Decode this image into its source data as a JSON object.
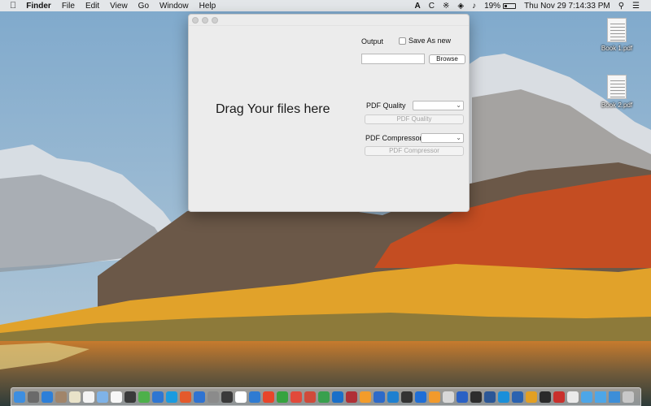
{
  "menubar": {
    "apple_icon": "apple-logo-icon",
    "menus": [
      "Finder",
      "File",
      "Edit",
      "View",
      "Go",
      "Window",
      "Help"
    ],
    "status": {
      "battery_percent": "19%",
      "datetime": "Thu Nov 29  7:14:33 PM",
      "c_label": "C"
    }
  },
  "desktop": {
    "icons": [
      {
        "label": "Book 1.pdf"
      },
      {
        "label": "Book 2.pdf"
      }
    ]
  },
  "window": {
    "drop_text": "Drag Your files here",
    "output_label": "Output",
    "save_as_new_label": "Save As new",
    "output_path_value": "",
    "browse_label": "Browse",
    "pdf_quality_label": "PDF Quality",
    "pdf_quality_button": "PDF Quality",
    "pdf_compressor_label": "PDF Compressor",
    "pdf_compressor_button": "PDF Compressor"
  },
  "dock": {
    "colors": [
      "#3d8ee0",
      "#6a6a6a",
      "#2d7fd8",
      "#a1856a",
      "#e9e3c9",
      "#f4f4f4",
      "#7fb3e8",
      "#f7f7f7",
      "#3a3a3a",
      "#4db04a",
      "#2f76d2",
      "#1a9be0",
      "#e45a2b",
      "#2f73d1",
      "#8b8b8b",
      "#3a3a3a",
      "#ffffff",
      "#2f7bd2",
      "#e8452a",
      "#36a33f",
      "#e14a3b",
      "#d04a3a",
      "#38a04d",
      "#1a6fc9",
      "#b03036",
      "#f39c2a",
      "#2d6ac9",
      "#1e80d0",
      "#333333",
      "#1f6ed6",
      "#f29a2c",
      "#d8d8d8",
      "#2a61c4",
      "#2d2d2d",
      "#2b5797",
      "#1a8fd9",
      "#2a62b0",
      "#e3a023",
      "#2a2a2a",
      "#c9302c",
      "#eaeaea",
      "#4da6e8",
      "#4da6e8",
      "#3d8ed8",
      "#c8c8c8"
    ]
  }
}
